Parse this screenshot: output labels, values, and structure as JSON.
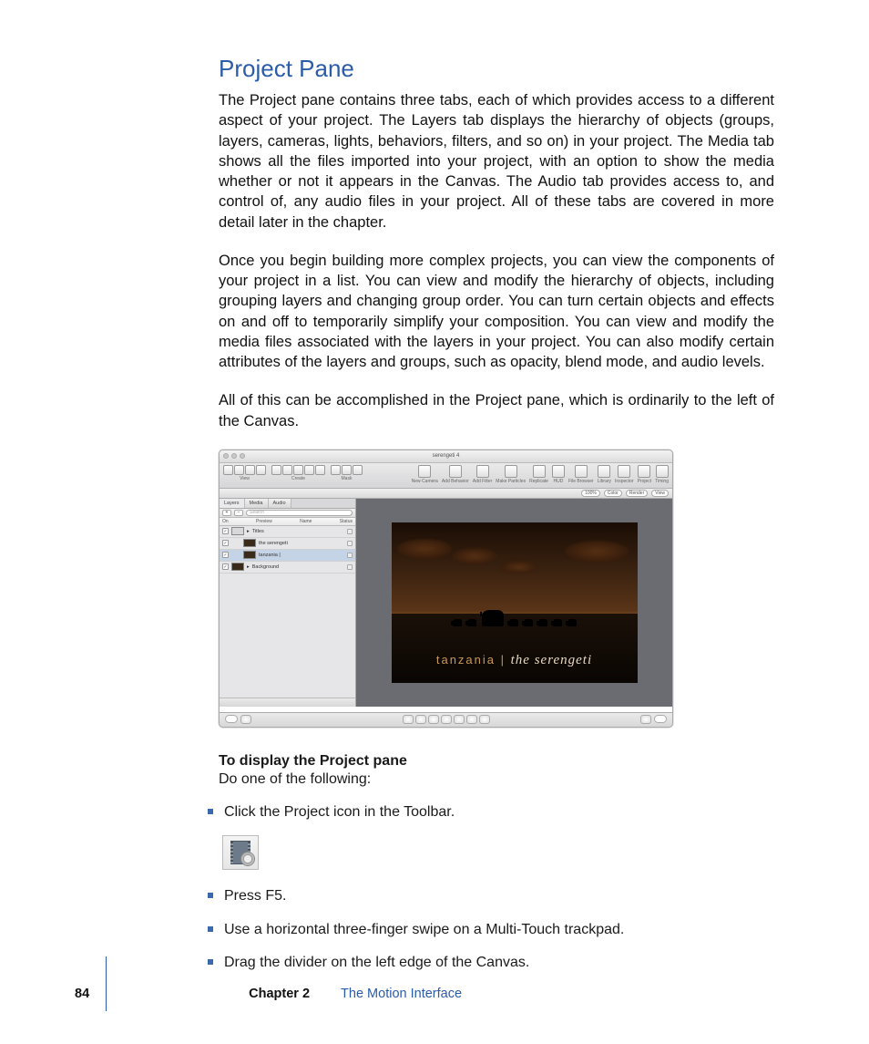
{
  "heading": "Project Pane",
  "paragraphs": [
    "The Project pane contains three tabs, each of which provides access to a different aspect of your project. The Layers tab displays the hierarchy of objects (groups, layers, cameras, lights, behaviors, filters, and so on) in your project. The Media tab shows all the files imported into your project, with an option to show the media whether or not it appears in the Canvas. The Audio tab provides access to, and control of, any audio files in your project. All of these tabs are covered in more detail later in the chapter.",
    "Once you begin building more complex projects, you can view the components of your project in a list. You can view and modify the hierarchy of objects, including grouping layers and changing group order. You can turn certain objects and effects on and off to temporarily simplify your composition. You can view and modify the media files associated with the layers in your project. You can also modify certain attributes of the layers and groups, such as opacity, blend mode, and audio levels.",
    "All of this can be accomplished in the Project pane, which is ordinarily to the left of the Canvas."
  ],
  "instruction_heading": "To display the Project pane",
  "instruction_sub": "Do one of the following:",
  "bullets": [
    "Click the Project icon in the Toolbar.",
    "Press F5.",
    "Use a horizontal three-finger swipe on a Multi-Touch trackpad.",
    "Drag the divider on the left edge of the Canvas."
  ],
  "footer": {
    "page": "84",
    "chapter_label": "Chapter 2",
    "chapter_title": "The Motion Interface"
  },
  "screenshot": {
    "title": "serengeti 4",
    "toolbar": {
      "view_label": "View",
      "create_label": "Create",
      "mask_label": "Mask",
      "right": [
        {
          "label": "New Camera"
        },
        {
          "label": "Add Behavior"
        },
        {
          "label": "Add Filter"
        },
        {
          "label": "Make Particles"
        },
        {
          "label": "Replicate"
        },
        {
          "label": "HUD"
        },
        {
          "label": "File Browser"
        },
        {
          "label": "Library"
        },
        {
          "label": "Inspector"
        },
        {
          "label": "Project"
        },
        {
          "label": "Timing"
        }
      ]
    },
    "optionsbar": {
      "zoom": "100%",
      "color": "Color",
      "render": "Render",
      "view": "View"
    },
    "tabs": {
      "layers": "Layers",
      "media": "Media",
      "audio": "Audio"
    },
    "search_placeholder": "Search",
    "columns": {
      "on": "On",
      "preview": "Preview",
      "name": "Name",
      "status": "Status"
    },
    "rows": [
      {
        "name": "Titles",
        "type": "group",
        "selected": false
      },
      {
        "name": "the serengeti",
        "type": "layer",
        "selected": false,
        "indent": 1
      },
      {
        "name": "tanzania |",
        "type": "layer",
        "selected": true,
        "indent": 1
      },
      {
        "name": "Background",
        "type": "group",
        "selected": false
      }
    ],
    "canvas_text": {
      "t1": "tanzania | ",
      "t2": "the serengeti"
    }
  }
}
